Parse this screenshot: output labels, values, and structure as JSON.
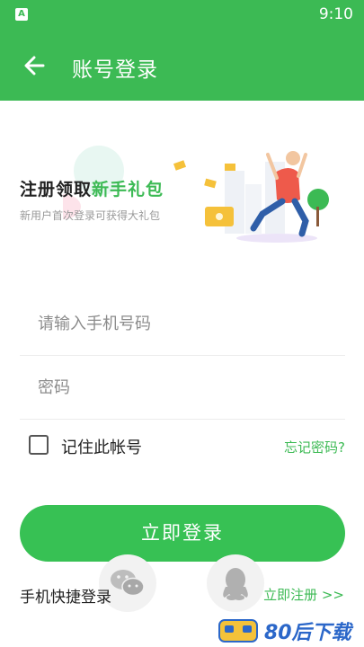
{
  "status_bar": {
    "time": "9:10",
    "app_icon_letter": "A"
  },
  "header": {
    "title": "账号登录"
  },
  "banner": {
    "title_part1": "注册领取",
    "title_part2": "新手礼包",
    "subtitle": "新用户首次登录可获得大礼包"
  },
  "form": {
    "phone_placeholder": "请输入手机号码",
    "password_placeholder": "密码",
    "remember_label": "记住此帐号",
    "forgot_label": "忘记密码?",
    "login_label": "立即登录"
  },
  "bottom": {
    "quick_login_label": "手机快捷登录",
    "register_label": "立即注册 >>"
  },
  "watermark": {
    "text": "80后下载"
  },
  "colors": {
    "primary": "#3cba54",
    "button": "#37c154",
    "link": "#3cba54"
  },
  "icons": [
    "back-arrow-icon",
    "wechat-icon",
    "qq-icon"
  ]
}
